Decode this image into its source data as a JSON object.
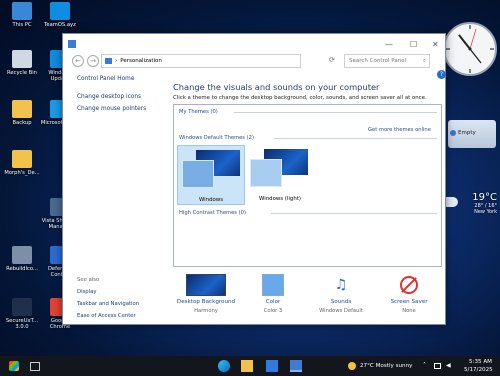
{
  "desktop": {
    "icons": [
      {
        "label": "This PC",
        "icon": "computer-icon",
        "color": "#3a86d8"
      },
      {
        "label": "TeamOS.ayz",
        "icon": "edge-icon",
        "color": "#0f8de0"
      },
      {
        "label": "Recycle Bin",
        "icon": "recycle-bin-icon",
        "color": "#cfd8e3"
      },
      {
        "label": "Windows Update",
        "icon": "edge-icon",
        "color": "#0f8de0"
      },
      {
        "label": "Backup",
        "icon": "folder-icon",
        "color": "#f2c24d"
      },
      {
        "label": "Microsoft Edge",
        "icon": "edge-icon",
        "color": "#1b9be6"
      },
      {
        "label": "Morph's_De...",
        "icon": "folder-icon",
        "color": "#f2c24d"
      },
      {
        "label": "Vista Shortcut Manager",
        "icon": "app-icon",
        "color": "#4a6a90"
      },
      {
        "label": "RebuildIco...",
        "icon": "app-icon",
        "color": "#7c8fa6"
      },
      {
        "label": "Defender Control",
        "icon": "shield-icon",
        "color": "#2d6bd1"
      },
      {
        "label": "SecureUxT... 3.0.0",
        "icon": "app-icon",
        "color": "#20304a"
      },
      {
        "label": "Google Chrome",
        "icon": "chrome-icon",
        "color": "#e44234"
      }
    ]
  },
  "window": {
    "breadcrumb": "Personalization",
    "search_placeholder": "Search Control Panel",
    "help": "?",
    "left_links": [
      "Control Panel Home",
      "Change desktop icons",
      "Change mouse pointers"
    ],
    "see_also_title": "See also",
    "see_also": [
      "Display",
      "Taskbar and Navigation",
      "Ease of Access Center"
    ],
    "heading": "Change the visuals and sounds on your computer",
    "subheading": "Click a theme to change the desktop background, color, sounds, and screen saver all at once.",
    "sections": {
      "my_themes": "My Themes (0)",
      "get_more": "Get more themes online",
      "default_themes": "Windows Default Themes (2)",
      "high_contrast": "High Contrast Themes (0)"
    },
    "themes": [
      {
        "label": "Windows",
        "selected": true
      },
      {
        "label": "Windows (light)",
        "selected": false
      }
    ],
    "bottom_items": [
      {
        "label": "Desktop Background",
        "value": "Harmony"
      },
      {
        "label": "Color",
        "value": "Color 3"
      },
      {
        "label": "Sounds",
        "value": "Windows Default"
      },
      {
        "label": "Screen Saver",
        "value": "None"
      }
    ]
  },
  "gadgets": {
    "weather_temp": "19°C",
    "weather_range": "28° / 16°",
    "weather_city": "New York",
    "notes_text": "Empty"
  },
  "taskbar": {
    "weather": "27°C  Mostly sunny",
    "time": "5:35 AM",
    "date": "5/17/2025"
  }
}
